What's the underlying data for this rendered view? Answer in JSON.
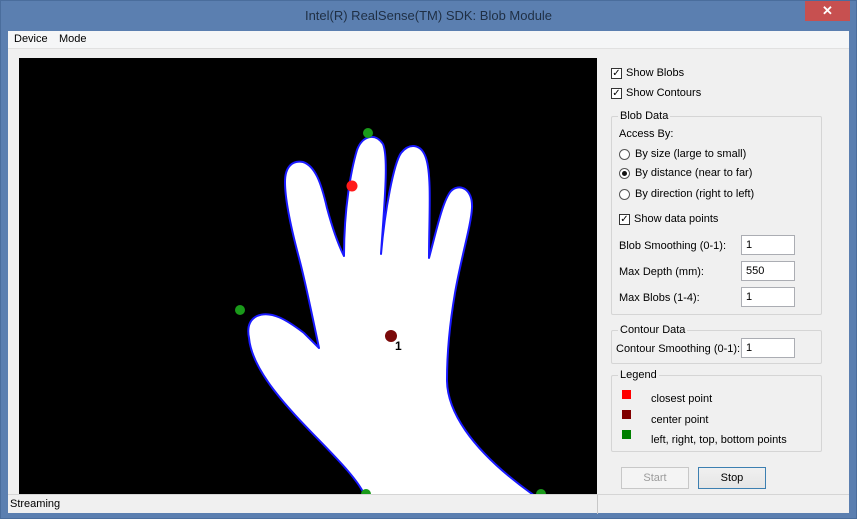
{
  "window": {
    "title": "Intel(R) RealSense(TM) SDK: Blob Module",
    "close_glyph": "✕"
  },
  "menu": {
    "items": [
      "Device",
      "Mode"
    ]
  },
  "options": {
    "show_blobs": {
      "label": "Show Blobs",
      "checked": true
    },
    "show_contours": {
      "label": "Show Contours",
      "checked": true
    }
  },
  "blob_data": {
    "title": "Blob Data",
    "access_by_label": "Access By:",
    "radios": [
      {
        "label": "By size (large to small)",
        "selected": false
      },
      {
        "label": "By distance (near to far)",
        "selected": true
      },
      {
        "label": "By direction (right to left)",
        "selected": false
      }
    ],
    "show_data_points": {
      "label": "Show data points",
      "checked": true
    },
    "fields": [
      {
        "label": "Blob Smoothing (0-1):",
        "value": "1"
      },
      {
        "label": "Max Depth (mm):",
        "value": "550"
      },
      {
        "label": "Max Blobs (1-4):",
        "value": "1"
      }
    ]
  },
  "contour_data": {
    "title": "Contour Data",
    "field": {
      "label": "Contour Smoothing (0-1):",
      "value": "1"
    }
  },
  "legend": {
    "title": "Legend",
    "items": [
      {
        "label": "closest point",
        "color": "#ff0000"
      },
      {
        "label": "center point",
        "color": "#800000"
      },
      {
        "label": "left, right, top, bottom points",
        "color": "#008000"
      }
    ]
  },
  "buttons": {
    "start": "Start",
    "stop": "Stop"
  },
  "video": {
    "blob_index": "1"
  },
  "status": {
    "text": "Streaming"
  }
}
